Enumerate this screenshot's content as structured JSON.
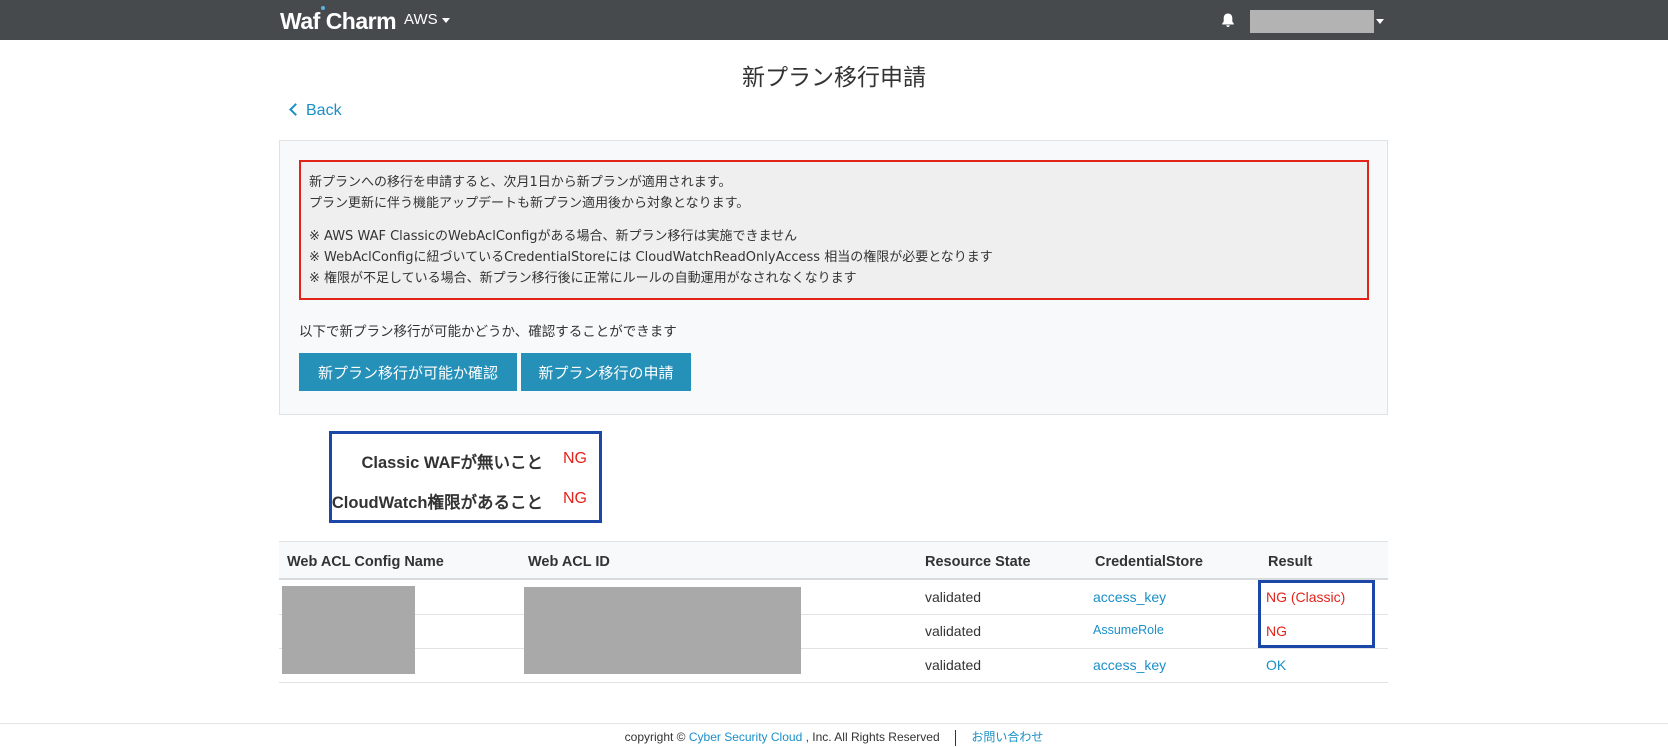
{
  "header": {
    "logo_text": "Waf Charm",
    "provider": "AWS",
    "brand_colors": {
      "topbar": "#464a4c",
      "link": "#1a8fc8",
      "button": "#2590b8",
      "error": "#e2231a",
      "highlight_box": "#1a47a8"
    },
    "icons": {
      "bell": "bell-icon",
      "user_menu": "chevron-down-icon"
    }
  },
  "page": {
    "title": "新プラン移行申請",
    "back_label": "Back"
  },
  "notice": {
    "line1": "新プランへの移行を申請すると、次月1日から新プランが適用されます。",
    "line2": "プラン更新に伴う機能アップデートも新プラン適用後から対象となります。",
    "note1": "※ AWS WAF ClassicのWebAclConfigがある場合、新プラン移行は実施できません",
    "note2": "※ WebAclConfigに紐づいているCredentialStoreには CloudWatchReadOnlyAccess 相当の権限が必要となります",
    "note3": "※ 権限が不足している場合、新プラン移行後に正常にルールの自動運用がなされなくなります"
  },
  "check_section": {
    "description": "以下で新プラン移行が可能かどうか、確認することができます",
    "check_button": "新プラン移行が可能か確認",
    "apply_button": "新プラン移行の申請"
  },
  "checks": [
    {
      "label": "Classic WAFが無いこと",
      "value": "NG"
    },
    {
      "label": "CloudWatch権限があること",
      "value": "NG"
    }
  ],
  "table": {
    "headers": [
      "Web ACL Config Name",
      "Web ACL ID",
      "Resource State",
      "CredentialStore",
      "Result"
    ],
    "rows": [
      {
        "state": "validated",
        "credential": "access_key",
        "result": "NG (Classic)",
        "result_color": "#e2231a"
      },
      {
        "state": "validated",
        "credential": "AssumeRole",
        "result": "NG",
        "result_color": "#e2231a"
      },
      {
        "state": "validated",
        "credential": "access_key",
        "result": "OK",
        "result_color": "#1a8fc8"
      }
    ]
  },
  "footer": {
    "copyright_prefix": "copyright ©",
    "company_link": "Cyber Security Cloud",
    "copyright_suffix": ", Inc. All Rights Reserved",
    "contact_link": "お問い合わせ"
  }
}
